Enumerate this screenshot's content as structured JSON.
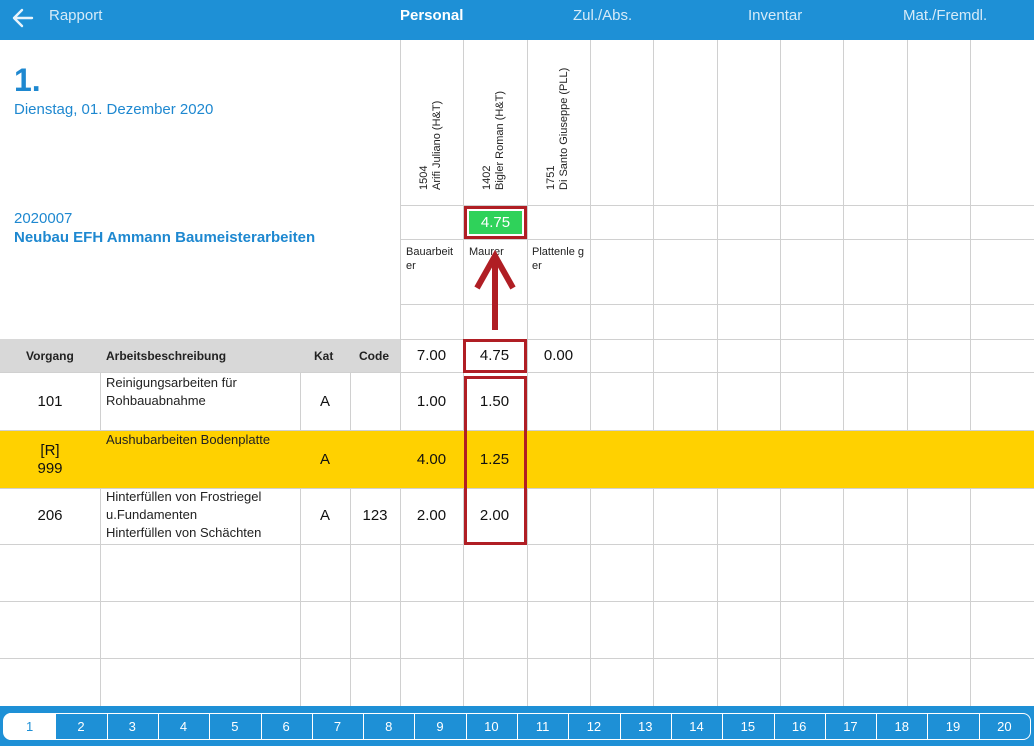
{
  "topbar": {
    "back_label": "Rapport",
    "tabs": [
      {
        "label": "Personal",
        "active": true
      },
      {
        "label": "Zul./Abs.",
        "active": false
      },
      {
        "label": "Inventar",
        "active": false
      },
      {
        "label": "Mat./Fremdl.",
        "active": false
      }
    ]
  },
  "header": {
    "day": "1.",
    "date": "Dienstag, 01. Dezember 2020",
    "project_number": "2020007",
    "project_name": "Neubau EFH Ammann Baumeisterarbeiten"
  },
  "workers": [
    {
      "id": "1504",
      "name": "Arifi Juliano (H&T)",
      "role": "Bauarbeiter",
      "role_display": "Bauarbeit er",
      "total": "7.00",
      "header_value": ""
    },
    {
      "id": "1402",
      "name": "Bigler Roman (H&T)",
      "role": "Maurer",
      "role_display": "Maurer",
      "total": "4.75",
      "header_value": "4.75"
    },
    {
      "id": "1751",
      "name": "Di Santo Giuseppe (PLL)",
      "role": "Plattenleger",
      "role_display": "Plattenle ger",
      "total": "0.00",
      "header_value": ""
    }
  ],
  "columns": {
    "vorgang": "Vorgang",
    "arbeitsbeschreibung": "Arbeitsbeschreibung",
    "kat": "Kat",
    "code": "Code"
  },
  "rows": [
    {
      "vorgang": "101",
      "beschreibung": "Reinigungsarbeiten für Rohbauabnahme",
      "kat": "A",
      "code": "",
      "hours": [
        "1.00",
        "1.50",
        ""
      ],
      "highlighted": false
    },
    {
      "vorgang_prefix": "[R]",
      "vorgang": "999",
      "beschreibung": "Aushubarbeiten Bodenplatte",
      "kat": "A",
      "code": "",
      "hours": [
        "4.00",
        "1.25",
        ""
      ],
      "highlighted": true
    },
    {
      "vorgang": "206",
      "beschreibung_lines": [
        "Hinterfüllen von Frostriegel",
        "u.Fundamenten",
        "Hinterfüllen von Schächten"
      ],
      "kat": "A",
      "code": "123",
      "hours": [
        "2.00",
        "2.00",
        ""
      ],
      "highlighted": false
    }
  ],
  "colors": {
    "primary": "#1e90d6",
    "highlight_row": "#ffd100",
    "annotation": "#b01e24",
    "positive_cell": "#2fd25a"
  },
  "pager": {
    "pages": [
      "1",
      "2",
      "3",
      "4",
      "5",
      "6",
      "7",
      "8",
      "9",
      "10",
      "11",
      "12",
      "13",
      "14",
      "15",
      "16",
      "17",
      "18",
      "19",
      "20"
    ],
    "active": "1"
  }
}
